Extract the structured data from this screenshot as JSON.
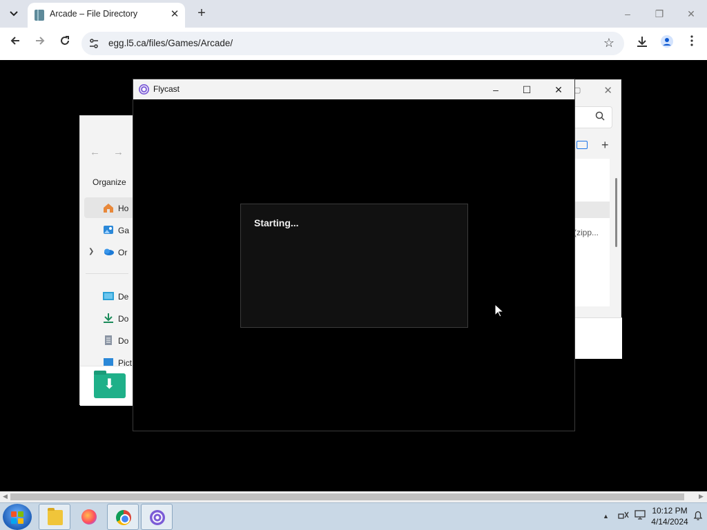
{
  "browser": {
    "tab": {
      "title": "Arcade – File Directory",
      "close": "✕"
    },
    "new_tab": "+",
    "window_controls": {
      "minimize": "–",
      "restore": "❐",
      "close": "✕"
    },
    "address": "egg.l5.ca/files/Games/Arcade/"
  },
  "explorer": {
    "organize": "Organize",
    "nav_items": [
      {
        "label": "Ho",
        "icon": "home-icon"
      },
      {
        "label": "Ga",
        "icon": "gallery-icon"
      },
      {
        "label": "Or",
        "icon": "onedrive-icon"
      },
      {
        "label": "De",
        "icon": "desktop-icon"
      },
      {
        "label": "Do",
        "icon": "downloads-icon"
      },
      {
        "label": "Do",
        "icon": "documents-icon"
      },
      {
        "label": "Pict",
        "icon": "pictures-icon"
      }
    ],
    "partial_file": "(zipp..."
  },
  "flycast": {
    "title": "Flycast",
    "status": "Starting...",
    "controls": {
      "minimize": "–",
      "maximize": "☐",
      "close": "✕"
    }
  },
  "taskbar": {
    "apps": [
      "file-explorer",
      "firefox",
      "chrome",
      "flycast"
    ],
    "time": "10:12 PM",
    "date": "4/14/2024"
  },
  "colors": {
    "flycast_accent": "#7b5bd6",
    "explorer_folder": "#1fb089",
    "chrome_accent": "#1a73e8"
  }
}
